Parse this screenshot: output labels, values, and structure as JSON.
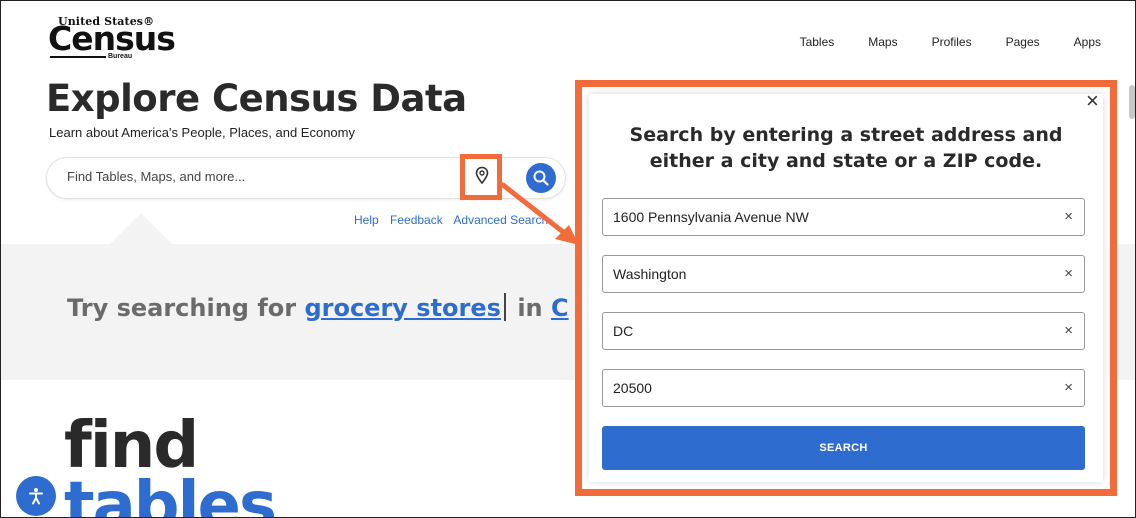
{
  "logo": {
    "small": "United States®",
    "big": "Census",
    "bureau": "Bureau"
  },
  "topnav": [
    "Tables",
    "Maps",
    "Profiles",
    "Pages",
    "Apps"
  ],
  "page": {
    "title": "Explore Census Data",
    "subtitle": "Learn about America's People, Places, and Economy",
    "search_placeholder": "Find Tables, Maps, and more...",
    "links": [
      "Help",
      "Feedback",
      "Advanced Search"
    ]
  },
  "try": {
    "prefix": "Try searching for",
    "link": "grocery stores",
    "suffix": "in",
    "trail": "C"
  },
  "find": {
    "line1": "find",
    "line2": "tables"
  },
  "modal": {
    "title_line1": "Search by entering a street address and",
    "title_line2": "either a city and state or a ZIP code.",
    "close": "×",
    "fields": [
      {
        "value": "1600 Pennsylvania Avenue NW",
        "clear": "×"
      },
      {
        "value": "Washington",
        "clear": "×"
      },
      {
        "value": "DC",
        "clear": "×"
      },
      {
        "value": "20500",
        "clear": "×"
      }
    ],
    "submit": "SEARCH"
  },
  "colors": {
    "accent": "#2e6ccf",
    "highlight": "#f26b3a",
    "band": "#f3f3f3"
  },
  "icons": [
    "location-pin-icon",
    "magnifier-icon",
    "accessibility-icon",
    "close-icon"
  ]
}
